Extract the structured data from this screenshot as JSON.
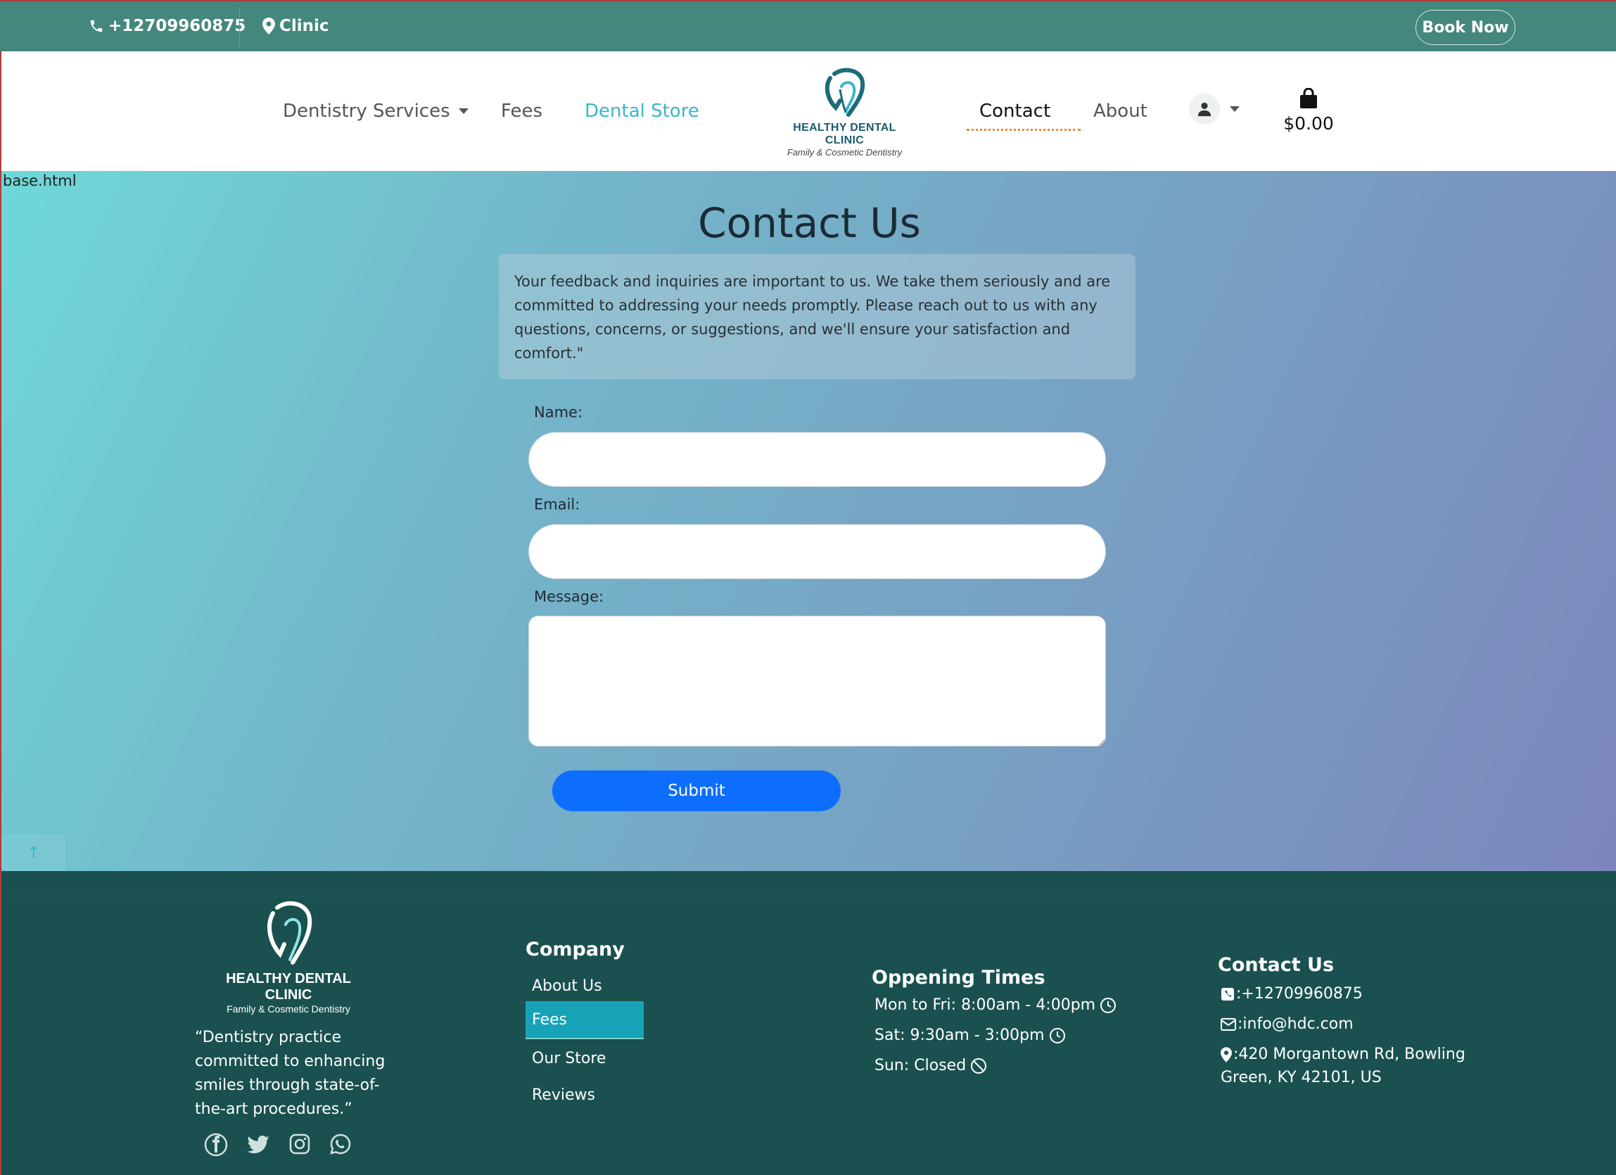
{
  "topbar": {
    "phone": "+12709960875",
    "clinic": "Clinic",
    "book_now": "Book Now"
  },
  "nav": {
    "items": [
      {
        "label": "Dentistry Services",
        "dropdown": true
      },
      {
        "label": "Fees"
      },
      {
        "label": "Dental Store",
        "active": true
      },
      {
        "label": "Contact",
        "current": true
      },
      {
        "label": "About"
      }
    ],
    "logo_title": "HEALTHY DENTAL CLINIC",
    "logo_sub": "Family & Cosmetic Dentistry",
    "cart_total": "$0.00"
  },
  "main": {
    "base_label": "base.html",
    "title": "Contact Us",
    "intro": "Your feedback and inquiries are important to us. We take them seriously and are committed to addressing your needs promptly. Please reach out to us with any questions, concerns, or suggestions, and we'll ensure your satisfaction and comfort.\"",
    "form": {
      "name_label": "Name:",
      "name_value": "",
      "email_label": "Email:",
      "email_value": "",
      "message_label": "Message:",
      "message_value": "",
      "submit": "Submit"
    },
    "back_to_top": "↑"
  },
  "footer": {
    "logo_title": "HEALTHY DENTAL CLINIC",
    "logo_sub": "Family & Cosmetic Dentistry",
    "quote": "“Dentistry practice committed to enhancing smiles through state-of-the-art procedures.”",
    "company": {
      "heading": "Company",
      "links": [
        "About Us",
        "Fees",
        "Our Store",
        "Reviews"
      ]
    },
    "hours": {
      "heading": "Oppening Times",
      "rows": [
        "Mon to Fri: 8:00am - 4:00pm",
        "Sat: 9:30am - 3:00pm",
        "Sun: Closed"
      ]
    },
    "contact": {
      "heading": "Contact Us",
      "phone": ":+12709960875",
      "email": ":info@hdc.com",
      "address_line1": ":420 Morgantown Rd, Bowling",
      "address_line2": "Green, KY 42101, US"
    },
    "social_icons": [
      "facebook-icon",
      "twitter-icon",
      "instagram-icon",
      "whatsapp-icon"
    ]
  },
  "colors": {
    "topbar": "#44877d",
    "footer": "#1a5150",
    "accent": "#3bb5c9",
    "submit": "#0d6efd",
    "highlight": "#17a2b8"
  }
}
